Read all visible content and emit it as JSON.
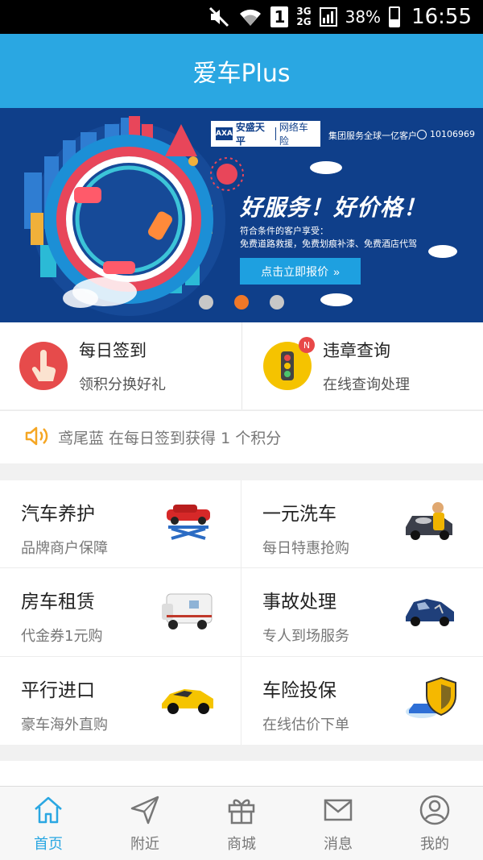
{
  "statusbar": {
    "sim_slot": "1",
    "network_top": "3G",
    "network_bottom": "2G",
    "battery_percent": "38%",
    "time": "16:55",
    "icons": [
      "mute-icon",
      "wifi-icon",
      "sim-icon",
      "signal-icon",
      "battery-icon"
    ]
  },
  "header": {
    "title": "爱车Plus"
  },
  "banner": {
    "brand": "安盛天平",
    "brand_sub": "网络车险",
    "logo_text": "AXA",
    "group_text": "集团服务全球一亿客户",
    "phone": "10106969",
    "slogan": "好服务！好价格！",
    "sub_line1": "符合条件的客户享受：",
    "sub_line2": "免费道路救援，免费划痕补漆、免费酒店代驾",
    "cta": "点击立即报价",
    "slides": 3,
    "active_slide": 2,
    "colors": {
      "background": "#0f3f8a",
      "cta": "#1ea0e0",
      "dot_active": "#f07828"
    }
  },
  "quick": [
    {
      "title": "每日签到",
      "subtitle": "领积分换好礼",
      "icon": "hand-tap-icon"
    },
    {
      "title": "违章查询",
      "subtitle": "在线查询处理",
      "icon": "traffic-light-icon",
      "badge": "N"
    }
  ],
  "ticker": {
    "icon": "speaker-icon",
    "message": "鸢尾蓝 在每日签到获得 1 个积分"
  },
  "services": [
    {
      "title": "汽车养护",
      "subtitle": "品牌商户保障",
      "image": "car-lift-image"
    },
    {
      "title": "一元洗车",
      "subtitle": "每日特惠抢购",
      "image": "car-wash-image"
    },
    {
      "title": "房车租赁",
      "subtitle": "代金券1元购",
      "image": "rv-image"
    },
    {
      "title": "事故处理",
      "subtitle": "专人到场服务",
      "image": "damaged-car-image"
    },
    {
      "title": "平行进口",
      "subtitle": "豪车海外直购",
      "image": "sports-car-image"
    },
    {
      "title": "车险投保",
      "subtitle": "在线估价下单",
      "image": "insurance-shield-image"
    }
  ],
  "tabs": [
    {
      "label": "首页",
      "icon": "home-icon",
      "active": true
    },
    {
      "label": "附近",
      "icon": "navigate-icon",
      "active": false
    },
    {
      "label": "商城",
      "icon": "gift-icon",
      "active": false
    },
    {
      "label": "消息",
      "icon": "mail-icon",
      "active": false
    },
    {
      "label": "我的",
      "icon": "user-icon",
      "active": false
    }
  ],
  "colors": {
    "primary": "#2aa7e2",
    "badge": "#e84848"
  }
}
